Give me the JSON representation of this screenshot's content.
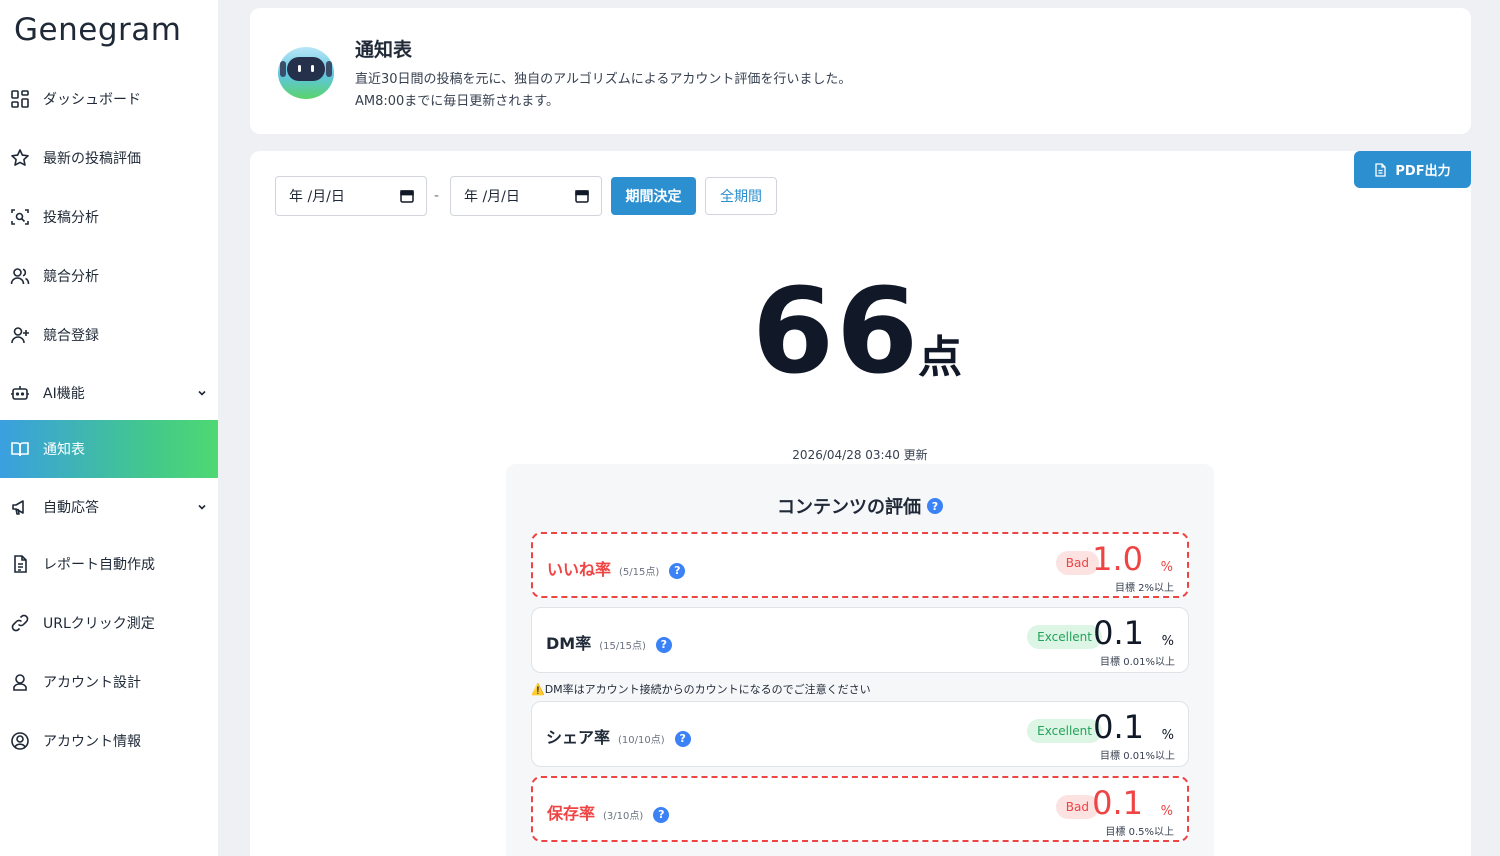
{
  "app": {
    "logo": "Genegram"
  },
  "sidebar": {
    "items": [
      {
        "label": "ダッシュボード",
        "icon": "grid-icon"
      },
      {
        "label": "最新の投稿評価",
        "icon": "star-icon"
      },
      {
        "label": "投稿分析",
        "icon": "scan-icon"
      },
      {
        "label": "競合分析",
        "icon": "users-icon"
      },
      {
        "label": "競合登録",
        "icon": "user-plus-icon"
      },
      {
        "label": "AI機能",
        "icon": "bot-icon",
        "expandable": true
      },
      {
        "label": "通知表",
        "icon": "book-icon",
        "active": true
      },
      {
        "label": "自動応答",
        "icon": "megaphone-icon",
        "expandable": true
      },
      {
        "label": "レポート自動作成",
        "icon": "document-icon"
      },
      {
        "label": "URLクリック測定",
        "icon": "link-icon"
      },
      {
        "label": "アカウント設計",
        "icon": "user-pin-icon"
      },
      {
        "label": "アカウント情報",
        "icon": "user-circle-icon"
      }
    ]
  },
  "header": {
    "title": "通知表",
    "desc1": "直近30日間の投稿を元に、独自のアルゴリズムによるアカウント評価を行いました。",
    "desc2": "AM8:00までに毎日更新されます。"
  },
  "toolbar": {
    "pdf_label": "PDF出力",
    "date_from_placeholder": "年 /月/日",
    "date_to_placeholder": "年 /月/日",
    "separator": "-",
    "apply_label": "期間決定",
    "all_label": "全期間"
  },
  "score": {
    "value": "66",
    "unit": "点",
    "updated": "2026/04/28 03:40 更新"
  },
  "evaluation": {
    "title": "コンテンツの評価",
    "help": "?",
    "dm_note": "⚠️DM率はアカウント接続からのカウントになるのでご注意ください",
    "metrics": [
      {
        "name": "いいね率",
        "points": "(5/15点)",
        "status": "Bad",
        "value": "1.0",
        "unit": "%",
        "target": "目標 2%以上"
      },
      {
        "name": "DM率",
        "points": "(15/15点)",
        "status": "Excellent",
        "value": "0.1",
        "unit": "%",
        "target": "目標 0.01%以上"
      },
      {
        "name": "シェア率",
        "points": "(10/10点)",
        "status": "Excellent",
        "value": "0.1",
        "unit": "%",
        "target": "目標 0.01%以上"
      },
      {
        "name": "保存率",
        "points": "(3/10点)",
        "status": "Bad",
        "value": "0.1",
        "unit": "%",
        "target": "目標 0.5%以上"
      }
    ]
  },
  "colors": {
    "accent": "#2b8fd0",
    "bad": "#ef4444",
    "excellent": "#22a35a",
    "active_gradient_start": "#3a9fe0",
    "active_gradient_end": "#4fd873"
  }
}
